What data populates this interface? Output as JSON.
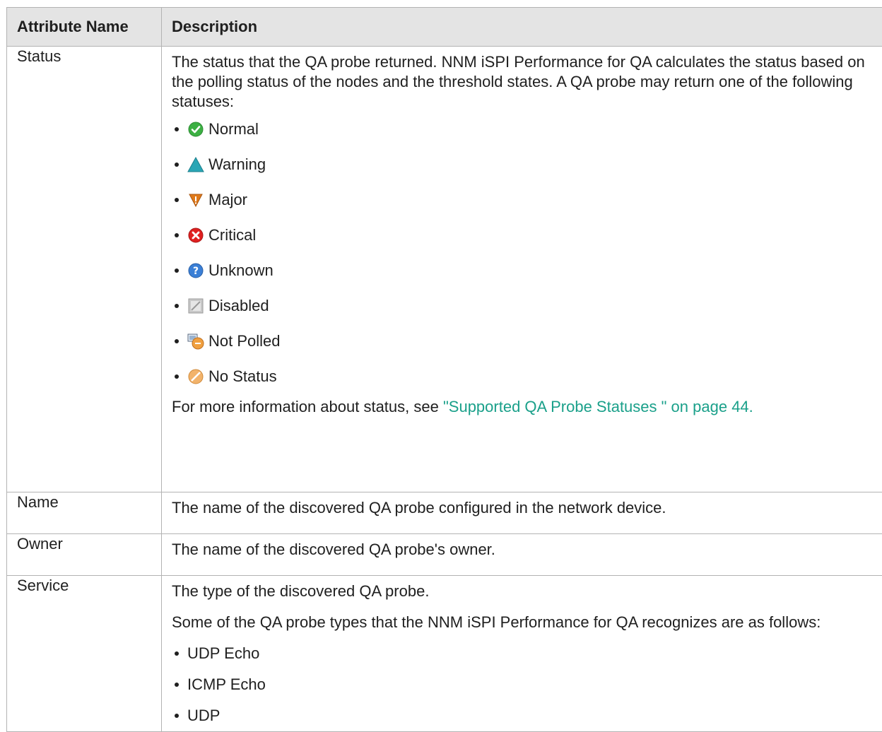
{
  "table": {
    "headers": [
      "Attribute Name",
      "Description"
    ],
    "status": {
      "name": "Status",
      "intro": "The status that the QA probe returned. NNM iSPI Performance for QA calculates the status based on the polling status of the nodes and the threshold states. A QA probe may return one of the following statuses:",
      "items": [
        {
          "label": "Normal",
          "icon": "normal-check-icon",
          "color": "#3cb043"
        },
        {
          "label": "Warning",
          "icon": "warning-triangle-icon",
          "color": "#2aa6b5"
        },
        {
          "label": "Major",
          "icon": "major-down-triangle-icon",
          "color": "#e07a1a"
        },
        {
          "label": "Critical",
          "icon": "critical-x-icon",
          "color": "#e02020"
        },
        {
          "label": "Unknown",
          "icon": "unknown-question-icon",
          "color": "#3a7fd6"
        },
        {
          "label": "Disabled",
          "icon": "disabled-slash-icon",
          "color": "#b5b5b5"
        },
        {
          "label": "Not Polled",
          "icon": "not-polled-icon",
          "color": "#f0a040"
        },
        {
          "label": "No Status",
          "icon": "no-status-icon",
          "color": "#f2b36b"
        }
      ],
      "more_prefix": "For more information about status, see ",
      "more_link": "\"Supported QA Probe Statuses \" on page 44."
    },
    "name_row": {
      "name": "Name",
      "description": "The name of the discovered QA probe configured in the network device."
    },
    "owner_row": {
      "name": "Owner",
      "description": "The name of the discovered QA probe's owner."
    },
    "service_row": {
      "name": "Service",
      "description": "The type of the discovered QA probe.",
      "types_intro": "Some of the QA probe types that the NNM iSPI Performance for QA recognizes are as follows:",
      "types": [
        "UDP Echo",
        "ICMP Echo",
        "UDP"
      ]
    }
  },
  "colors": {
    "header_bg": "#e4e4e4",
    "border": "#b3b3b3",
    "link": "#1aa08a"
  }
}
